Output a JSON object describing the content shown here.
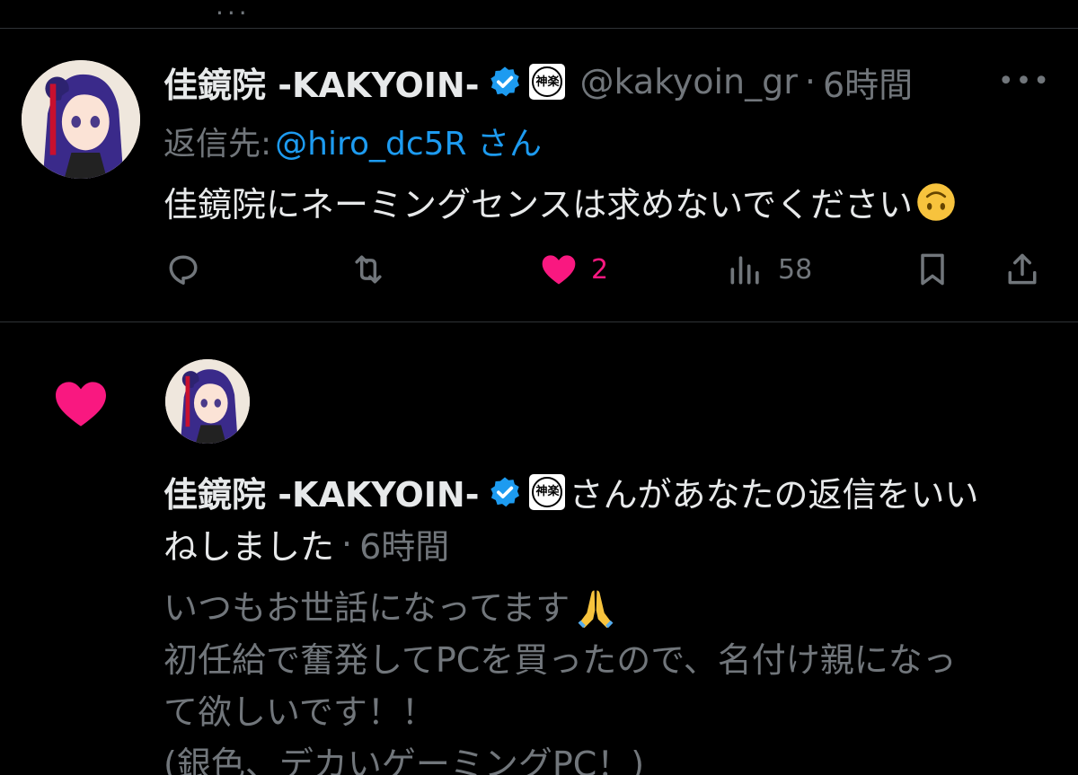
{
  "top": {
    "partial": "..."
  },
  "tweet": {
    "author_name": "佳鏡院 -KAKYOIN-",
    "seal_text": "神楽",
    "handle": "@kakyoin_gr",
    "separator": "·",
    "time": "6時間",
    "more": "•••",
    "reply_prefix": "返信先:",
    "reply_mention": "@hiro_dc5R さん",
    "text": "佳鏡院にネーミングセンスは求めないでください",
    "emoji": "upside-down-face",
    "actions": {
      "reply_count": "",
      "retweet_count": "",
      "like_count": "2",
      "views_count": "58"
    }
  },
  "notification": {
    "author_name": "佳鏡院 -KAKYOIN-",
    "seal_text": "神楽",
    "liked_text_1": "さんがあなたの返信をいい",
    "liked_text_2": "ねしました",
    "separator": "·",
    "time": "6時間",
    "quote": {
      "line1": "いつもお世話になってます",
      "line1_emoji": "folded-hands",
      "line2": "初任給で奮発してPCを買ったので、名付け親になっ",
      "line3": "て欲しいです！！",
      "line4": "(銀色、デカいゲーミングPC！)"
    }
  },
  "colors": {
    "background": "#000000",
    "text": "#e7e9ea",
    "muted": "#71767b",
    "accent": "#1d9bf0",
    "like": "#f91880",
    "divider": "#2f3336"
  }
}
